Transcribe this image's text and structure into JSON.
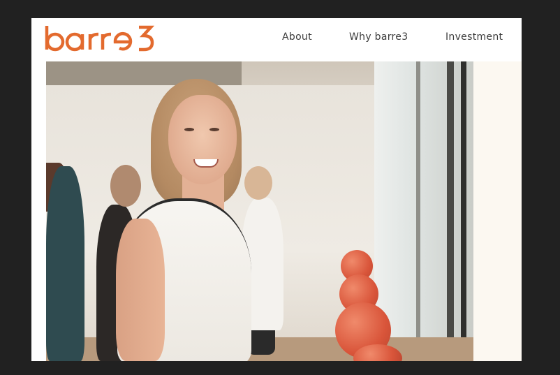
{
  "brand": {
    "logo_text": "barre3",
    "color": "#e36a2e"
  },
  "nav": {
    "items": [
      {
        "label": "About"
      },
      {
        "label": "Why barre3"
      },
      {
        "label": "Investment"
      }
    ]
  },
  "hero": {
    "image": "studio-photo"
  }
}
